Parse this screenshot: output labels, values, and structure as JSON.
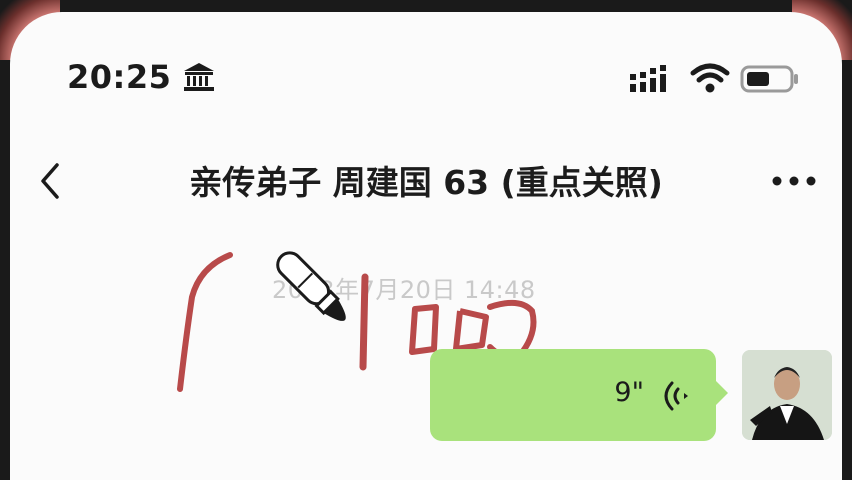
{
  "status_bar": {
    "time": "20:25",
    "left_icon": "bank-icon",
    "right_icons": [
      "signal-icon",
      "wifi-icon",
      "battery-icon"
    ]
  },
  "nav": {
    "back_icon": "chevron-left-icon",
    "title": "亲传弟子 周建国 63 (重点关照)",
    "more_icon": "more-dots-icon"
  },
  "chat": {
    "timestamp": "2023年7月20日 14:48",
    "messages": [
      {
        "type": "voice",
        "sender": "me",
        "duration": "9\"",
        "icon": "voice-wave-icon",
        "bubble_color": "#a9e27c"
      }
    ]
  },
  "overlay": {
    "icon": "paintbrush-icon",
    "stroke_color": "#b84a4a"
  }
}
